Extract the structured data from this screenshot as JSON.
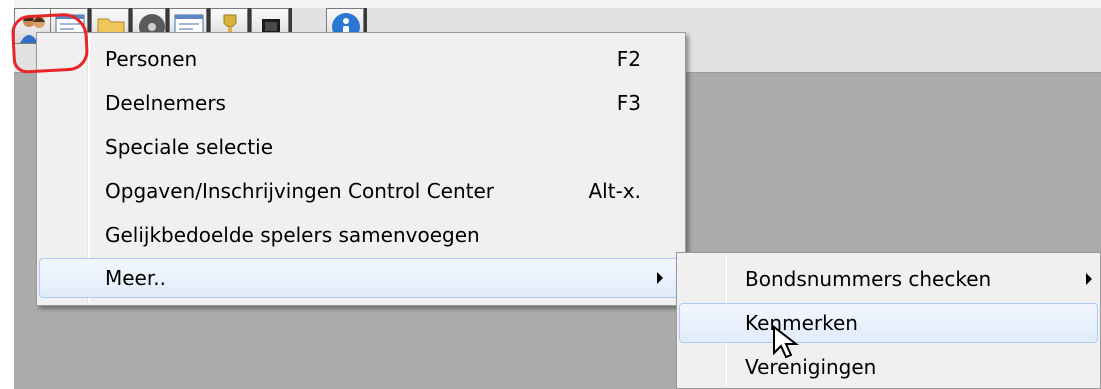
{
  "toolbar": {
    "buttons": [
      {
        "icon": "persons-icon"
      },
      {
        "icon": "form-icon"
      },
      {
        "icon": "folder-icon"
      },
      {
        "icon": "disc-icon"
      },
      {
        "icon": "form-icon"
      },
      {
        "icon": "trophy-icon"
      },
      {
        "icon": "monitor-icon"
      },
      {
        "icon": "help-icon"
      }
    ]
  },
  "main_menu": {
    "items": [
      {
        "label": "Personen",
        "shortcut": "F2"
      },
      {
        "label": "Deelnemers",
        "shortcut": "F3"
      },
      {
        "label": "Speciale selectie",
        "shortcut": ""
      },
      {
        "label": "Opgaven/Inschrijvingen Control Center",
        "shortcut": "Alt-x."
      },
      {
        "label": "Gelijkbedoelde spelers samenvoegen",
        "shortcut": ""
      },
      {
        "label": "Meer..",
        "shortcut": ""
      }
    ]
  },
  "sub_menu": {
    "items": [
      {
        "label": "Bondsnummers checken"
      },
      {
        "label": "Kenmerken"
      },
      {
        "label": "Verenigingen"
      }
    ]
  },
  "colors": {
    "highlight_border": "#aeccf1",
    "annotation_red": "#e8262a",
    "background": "#ababab"
  }
}
